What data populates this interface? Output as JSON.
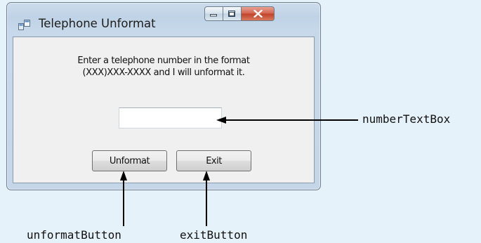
{
  "window": {
    "title": "Telephone Unformat",
    "app_icon": "window-form-icon"
  },
  "caption_buttons": {
    "minimize_icon": "minimize-icon",
    "maximize_icon": "maximize-icon",
    "close_icon": "close-icon",
    "close_color": "#c94a34"
  },
  "form": {
    "prompt_line1": "Enter a telephone number in the format",
    "prompt_line2": "(XXX)XXX-XXXX and I will unformat it.",
    "number_input_value": "",
    "unformat_label": "Unformat",
    "exit_label": "Exit"
  },
  "callouts": {
    "number_text_box": "numberTextBox",
    "unformat_button": "unformatButton",
    "exit_button": "exitButton"
  }
}
